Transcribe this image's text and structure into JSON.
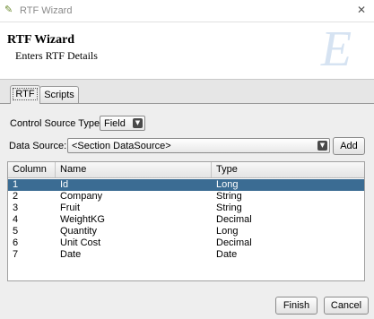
{
  "window": {
    "title": "RTF Wizard",
    "icon": "rtf-wizard-icon",
    "close_icon": "close-icon"
  },
  "header": {
    "title": "RTF Wizard",
    "subtitle": "Enters RTF Details",
    "logo_icon": "script-e-logo"
  },
  "tabs": [
    {
      "label": "RTF",
      "selected": true
    },
    {
      "label": "Scripts",
      "selected": false
    }
  ],
  "form": {
    "control_source_type_label": "Control Source Type:",
    "control_source_type_value": "Field",
    "data_source_label": "Data Source:",
    "data_source_value": "<Section DataSource>",
    "add_button": "Add"
  },
  "table": {
    "columns": [
      "Column",
      "Name",
      "Type"
    ],
    "rows": [
      {
        "column": "1",
        "name": "Id",
        "type": "Long",
        "selected": true
      },
      {
        "column": "2",
        "name": "Company",
        "type": "String"
      },
      {
        "column": "3",
        "name": "Fruit",
        "type": "String"
      },
      {
        "column": "4",
        "name": "WeightKG",
        "type": "Decimal"
      },
      {
        "column": "5",
        "name": "Quantity",
        "type": "Long"
      },
      {
        "column": "6",
        "name": "Unit Cost",
        "type": "Decimal"
      },
      {
        "column": "7",
        "name": "Date",
        "type": "Date"
      }
    ]
  },
  "footer": {
    "finish_button": "Finish",
    "cancel_button": "Cancel"
  },
  "colors": {
    "selection": "#3b6c93",
    "logo": "#d6e3f2",
    "app_icon": "#6b8a2e"
  }
}
